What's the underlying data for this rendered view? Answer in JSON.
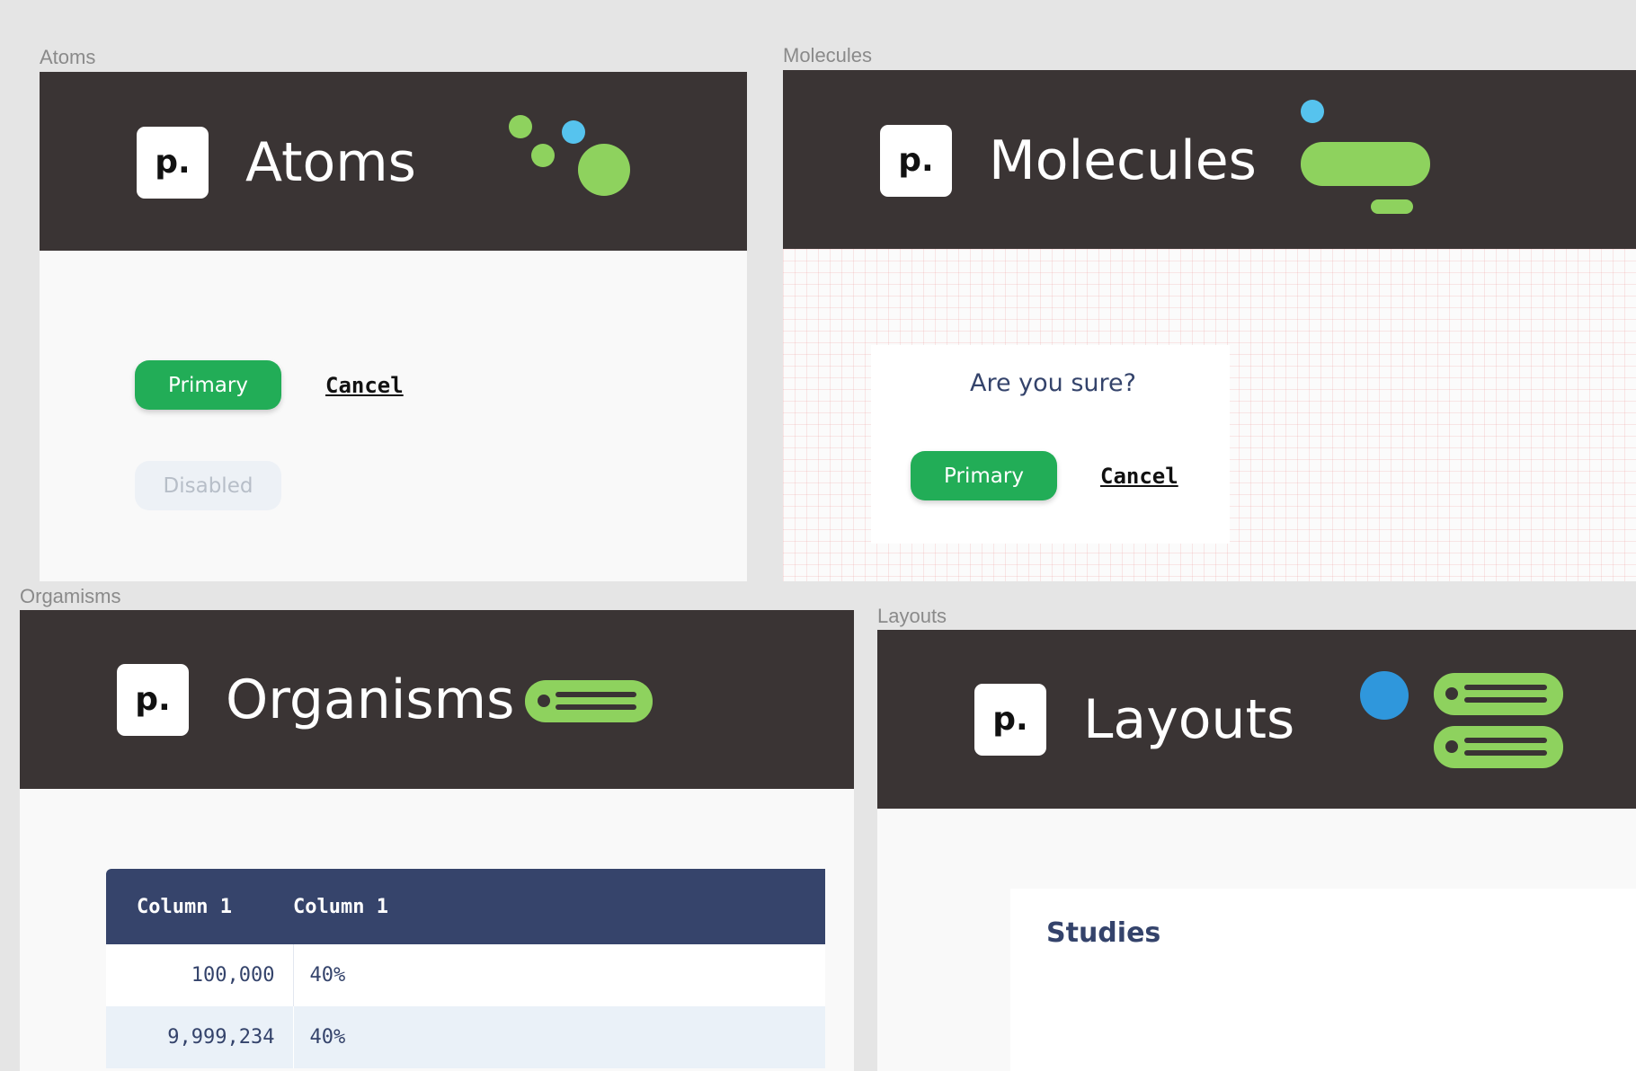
{
  "frames": {
    "atoms": {
      "label": "Atoms",
      "title": "Atoms",
      "logo": "p.",
      "primary_label": "Primary",
      "cancel_label": "Cancel",
      "disabled_label": "Disabled"
    },
    "molecules": {
      "label": "Molecules",
      "title": "Molecules",
      "logo": "p.",
      "dialog_text": "Are you sure?",
      "primary_label": "Primary",
      "cancel_label": "Cancel"
    },
    "organisms": {
      "label": "Orgamisms",
      "title": "Organisms",
      "logo": "p.",
      "table": {
        "columns": [
          "Column 1",
          "Column 1"
        ],
        "rows": [
          [
            "100,000",
            "40%"
          ],
          [
            "9,999,234",
            "40%"
          ]
        ]
      }
    },
    "layouts": {
      "label": "Layouts",
      "title": "Layouts",
      "logo": "p.",
      "card_title": "Studies"
    }
  },
  "colors": {
    "header_bg": "#3a3434",
    "accent_green": "#8ed25e",
    "accent_blue": "#56c3ee",
    "accent_dark_blue": "#2f97dc",
    "primary_button": "#22ad57",
    "table_header": "#36446b",
    "text_navy": "#34436b"
  },
  "icons": {
    "atoms": "atoms-dots-icon",
    "molecules": "molecules-pills-icon",
    "organisms": "organism-list-pill-icon",
    "layouts": "layout-list-stack-icon"
  }
}
